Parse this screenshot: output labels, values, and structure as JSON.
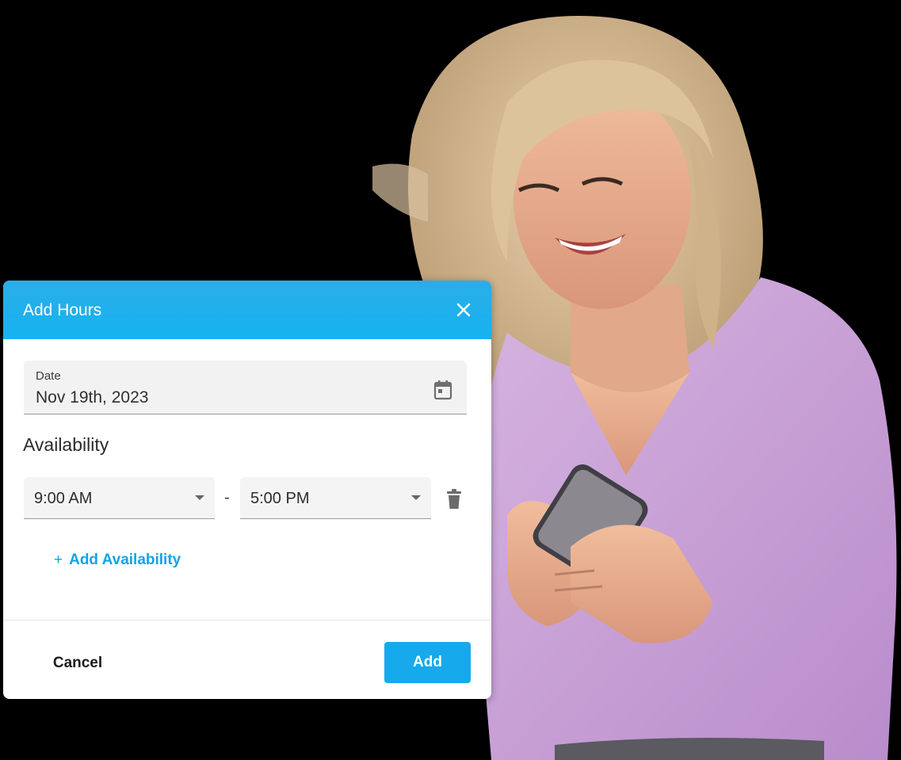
{
  "dialog": {
    "title": "Add Hours",
    "close_icon": "close-icon",
    "date_field": {
      "label": "Date",
      "value": "Nov 19th, 2023",
      "icon": "calendar-icon"
    },
    "availability": {
      "heading": "Availability",
      "ranges": [
        {
          "start": "9:00 AM",
          "separator": "-",
          "end": "5:00 PM",
          "delete_icon": "trash-icon"
        }
      ],
      "add_plus": "+",
      "add_label": "Add Availability"
    },
    "footer": {
      "cancel_label": "Cancel",
      "add_label": "Add"
    }
  },
  "colors": {
    "header": "#1fb0ef",
    "accent": "#16a9ec",
    "background": "#000000",
    "shirt": "#c8a0d4"
  }
}
